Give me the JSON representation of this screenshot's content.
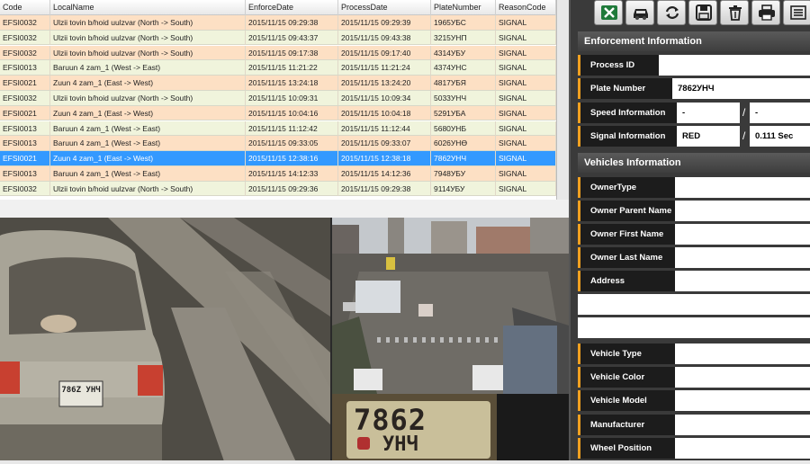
{
  "grid": {
    "columns": [
      "Code",
      "LocalName",
      "EnforceDate",
      "ProcessDate",
      "PlateNumber",
      "ReasonCode"
    ],
    "rows": [
      [
        "EFSI0032",
        "Ulzii tovin b/hoid uulzvar (North -> South)",
        "2015/11/15 09:29:38",
        "2015/11/15 09:29:39",
        "1965УБС",
        "SIGNAL"
      ],
      [
        "EFSI0032",
        "Ulzii tovin b/hoid uulzvar (North -> South)",
        "2015/11/15 09:43:37",
        "2015/11/15 09:43:38",
        "3215УНП",
        "SIGNAL"
      ],
      [
        "EFSI0032",
        "Ulzii tovin b/hoid uulzvar (North -> South)",
        "2015/11/15 09:17:38",
        "2015/11/15 09:17:40",
        "4314УБУ",
        "SIGNAL"
      ],
      [
        "EFSI0013",
        "Baruun 4 zam_1 (West -> East)",
        "2015/11/15 11:21:22",
        "2015/11/15 11:21:24",
        "4374УНС",
        "SIGNAL"
      ],
      [
        "EFSI0021",
        "Zuun 4 zam_1 (East -> West)",
        "2015/11/15 13:24:18",
        "2015/11/15 13:24:20",
        "4817УБЯ",
        "SIGNAL"
      ],
      [
        "EFSI0032",
        "Ulzii tovin b/hoid uulzvar (North -> South)",
        "2015/11/15 10:09:31",
        "2015/11/15 10:09:34",
        "5033УНЧ",
        "SIGNAL"
      ],
      [
        "EFSI0021",
        "Zuun 4 zam_1 (East -> West)",
        "2015/11/15 10:04:16",
        "2015/11/15 10:04:18",
        "5291УБА",
        "SIGNAL"
      ],
      [
        "EFSI0013",
        "Baruun 4 zam_1 (West -> East)",
        "2015/11/15 11:12:42",
        "2015/11/15 11:12:44",
        "5680УНБ",
        "SIGNAL"
      ],
      [
        "EFSI0013",
        "Baruun 4 zam_1 (West -> East)",
        "2015/11/15 09:33:05",
        "2015/11/15 09:33:07",
        "6026УНӨ",
        "SIGNAL"
      ],
      [
        "EFSI0021",
        "Zuun 4 zam_1 (East -> West)",
        "2015/11/15 12:38:16",
        "2015/11/15 12:38:18",
        "7862УНЧ",
        "SIGNAL"
      ],
      [
        "EFSI0013",
        "Baruun 4 zam_1 (West -> East)",
        "2015/11/15 14:12:33",
        "2015/11/15 14:12:36",
        "7948УБУ",
        "SIGNAL"
      ],
      [
        "EFSI0032",
        "Ulzii tovin b/hoid uulzvar (North -> South)",
        "2015/11/15 09:29:36",
        "2015/11/15 09:29:38",
        "9114УБУ",
        "SIGNAL"
      ]
    ],
    "selected_row_index": 9
  },
  "toolbar": {
    "icons": [
      "excel-icon",
      "car-icon",
      "refresh-icon",
      "save-icon",
      "trash-icon",
      "print-icon",
      "list-icon"
    ]
  },
  "enforcement": {
    "title": "Enforcement Information",
    "process_id_label": "Process ID",
    "process_id_value": "",
    "plate_label": "Plate Number",
    "plate_value": "7862УНЧ",
    "speed_label": "Speed Information",
    "speed_value_1": "-",
    "speed_value_2": "-",
    "signal_label": "Signal Information",
    "signal_value_1": "RED",
    "signal_value_2": "0.111 Sec",
    "separator": "/"
  },
  "vehicles": {
    "title": "Vehicles Information",
    "owner_type_label": "OwnerType",
    "owner_parent_label": "Owner Parent Name",
    "owner_first_label": "Owner First Name",
    "owner_last_label": "Owner Last Name",
    "address_label": "Address",
    "vehicle_type_label": "Vehicle Type",
    "vehicle_color_label": "Vehicle Color",
    "vehicle_model_label": "Vehicle Model",
    "manufacturer_label": "Manufacturer",
    "wheel_position_label": "Wheel Position"
  },
  "images": {
    "rear_plate_text": "786Z УНЧ",
    "crop_plate_line1": "7862",
    "crop_plate_line2": "УНЧ"
  },
  "colors": {
    "row_odd": "#fde0c4",
    "row_even": "#f0f4dc",
    "row_selected": "#3399ff",
    "label_accent": "#f0a020"
  }
}
